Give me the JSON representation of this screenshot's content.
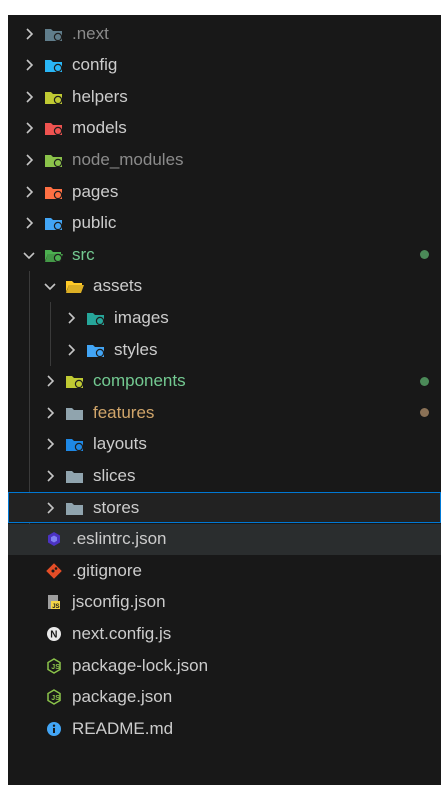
{
  "explorer": {
    "items": [
      {
        "label": ".next",
        "kind": "folder",
        "depth": 0,
        "expanded": false,
        "color": "#607d8b",
        "badge": "gear",
        "status": "dim"
      },
      {
        "label": "config",
        "kind": "folder",
        "depth": 0,
        "expanded": false,
        "color": "#29b6f6",
        "badge": "gear"
      },
      {
        "label": "helpers",
        "kind": "folder",
        "depth": 0,
        "expanded": false,
        "color": "#c0ca33",
        "badge": "wand"
      },
      {
        "label": "models",
        "kind": "folder",
        "depth": 0,
        "expanded": false,
        "color": "#ef5350",
        "badge": "box"
      },
      {
        "label": "node_modules",
        "kind": "folder",
        "depth": 0,
        "expanded": false,
        "color": "#8bc34a",
        "badge": "node",
        "status": "dim"
      },
      {
        "label": "pages",
        "kind": "folder",
        "depth": 0,
        "expanded": false,
        "color": "#ff7043",
        "badge": "page"
      },
      {
        "label": "public",
        "kind": "folder",
        "depth": 0,
        "expanded": false,
        "color": "#42a5f5",
        "badge": "globe"
      },
      {
        "label": "src",
        "kind": "folder",
        "depth": 0,
        "expanded": true,
        "color": "#4caf50",
        "badge": "code",
        "status": "green",
        "dot": "#4b8a58"
      },
      {
        "label": "assets",
        "kind": "folder",
        "depth": 1,
        "expanded": true,
        "color": "#ffca28",
        "badge": "none"
      },
      {
        "label": "images",
        "kind": "folder",
        "depth": 2,
        "expanded": false,
        "color": "#26a69a",
        "badge": "image"
      },
      {
        "label": "styles",
        "kind": "folder",
        "depth": 2,
        "expanded": false,
        "color": "#42a5f5",
        "badge": "css"
      },
      {
        "label": "components",
        "kind": "folder",
        "depth": 1,
        "expanded": false,
        "color": "#c0ca33",
        "badge": "grid",
        "status": "green",
        "dot": "#4b8a58"
      },
      {
        "label": "features",
        "kind": "folder",
        "depth": 1,
        "expanded": false,
        "color": "#90a4ae",
        "badge": "none",
        "status": "brown",
        "dot": "#8a7156"
      },
      {
        "label": "layouts",
        "kind": "folder",
        "depth": 1,
        "expanded": false,
        "color": "#1e88e5",
        "badge": "layout"
      },
      {
        "label": "slices",
        "kind": "folder",
        "depth": 1,
        "expanded": false,
        "color": "#90a4ae",
        "badge": "none"
      },
      {
        "label": "stores",
        "kind": "folder",
        "depth": 1,
        "expanded": false,
        "color": "#90a4ae",
        "badge": "none",
        "focused": true
      },
      {
        "label": ".eslintrc.json",
        "kind": "file",
        "depth": 0,
        "icon": "eslint-icon",
        "hover": true
      },
      {
        "label": ".gitignore",
        "kind": "file",
        "depth": 0,
        "icon": "git-icon"
      },
      {
        "label": "jsconfig.json",
        "kind": "file",
        "depth": 0,
        "icon": "jsconfig-icon"
      },
      {
        "label": "next.config.js",
        "kind": "file",
        "depth": 0,
        "icon": "nextjs-icon"
      },
      {
        "label": "package-lock.json",
        "kind": "file",
        "depth": 0,
        "icon": "npm-icon"
      },
      {
        "label": "package.json",
        "kind": "file",
        "depth": 0,
        "icon": "npm-icon"
      },
      {
        "label": "README.md",
        "kind": "file",
        "depth": 0,
        "icon": "info-icon"
      }
    ]
  }
}
